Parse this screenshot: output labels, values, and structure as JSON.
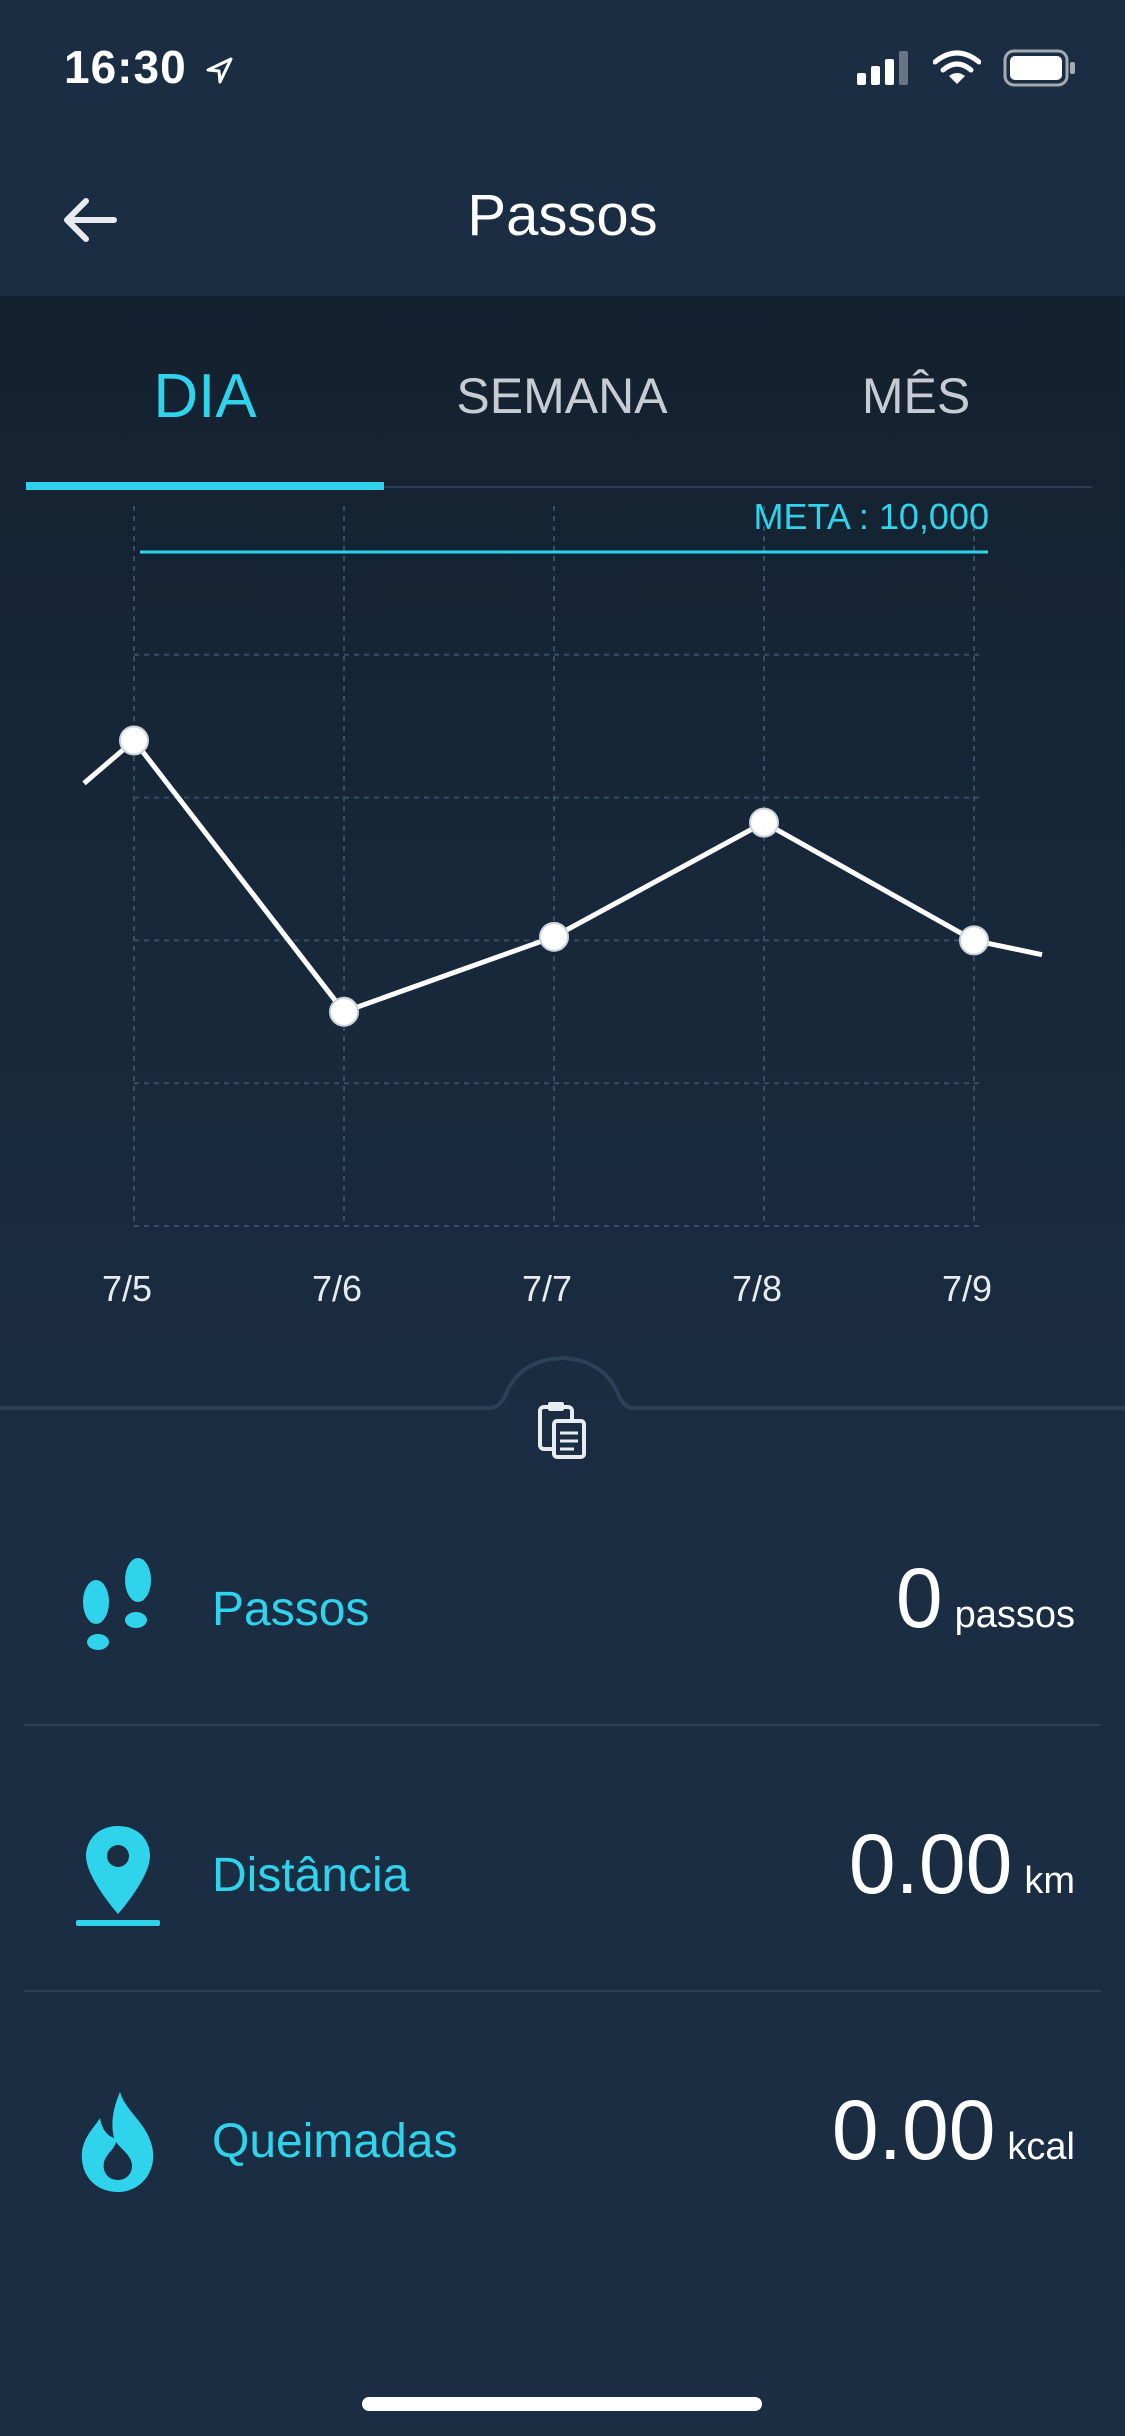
{
  "status_bar": {
    "time": "16:30"
  },
  "nav": {
    "title": "Passos"
  },
  "tabs": [
    {
      "label": "DIA",
      "active": true
    },
    {
      "label": "SEMANA",
      "active": false
    },
    {
      "label": "MÊS",
      "active": false
    }
  ],
  "colors": {
    "accent": "#2fd3ec",
    "background": "#1b2d42",
    "line": "#ffffff"
  },
  "chart_data": {
    "type": "line",
    "goal_label": "META : 10,000",
    "goal": 10000,
    "x": [
      "7/5",
      "7/6",
      "7/7",
      "7/8",
      "7/9"
    ],
    "values": [
      6800,
      3000,
      4050,
      5650,
      4000
    ],
    "edge_left": 6200,
    "edge_right": 3800,
    "ylim": [
      0,
      10000
    ],
    "grid": true
  },
  "stats": [
    {
      "icon": "footsteps-icon",
      "label": "Passos",
      "value": "0",
      "unit": "passos"
    },
    {
      "icon": "location-pin-icon",
      "label": "Distância",
      "value": "0.00",
      "unit": "km"
    },
    {
      "icon": "flame-icon",
      "label": "Queimadas",
      "value": "0.00",
      "unit": "kcal"
    }
  ]
}
